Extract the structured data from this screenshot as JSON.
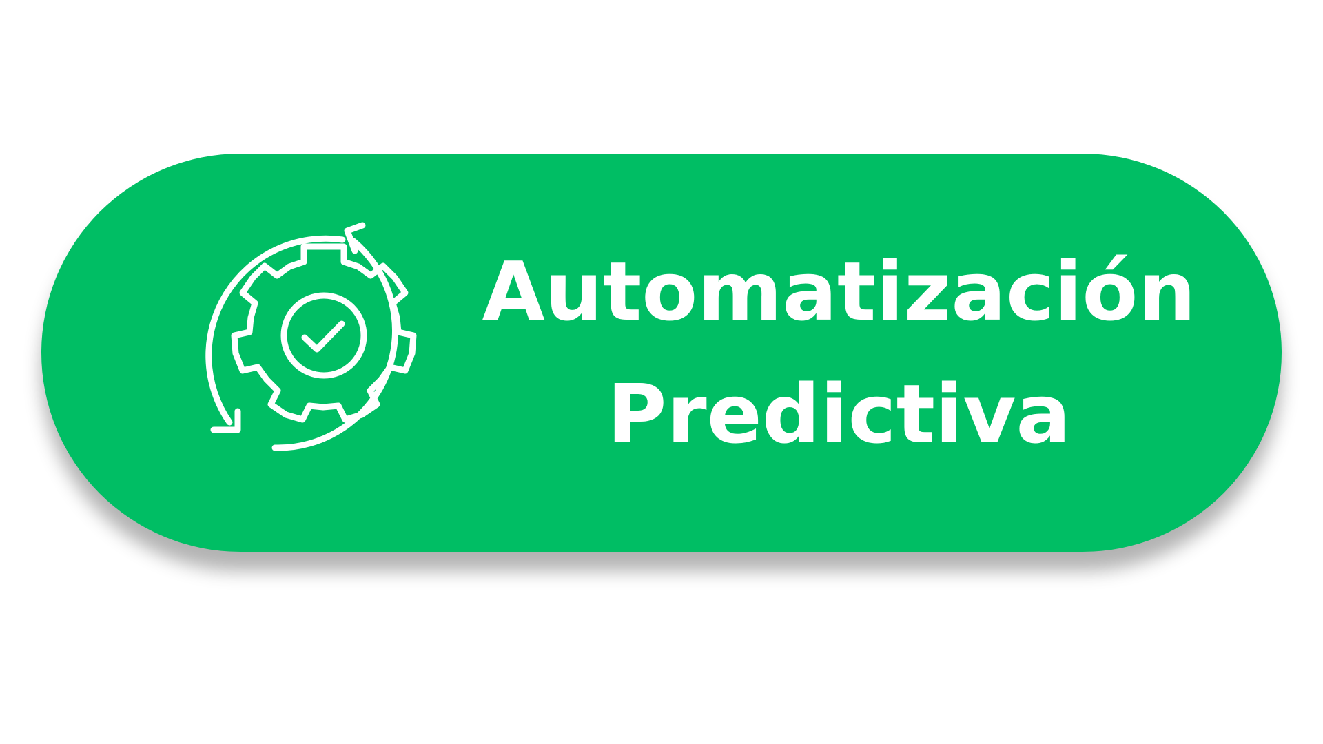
{
  "button": {
    "label_line1": "Automatización",
    "label_line2": "Predictiva",
    "icon": "gear-check-cycle-icon"
  },
  "colors": {
    "background": "#ffffff",
    "button_fill": "#00be64",
    "foreground": "#ffffff"
  }
}
